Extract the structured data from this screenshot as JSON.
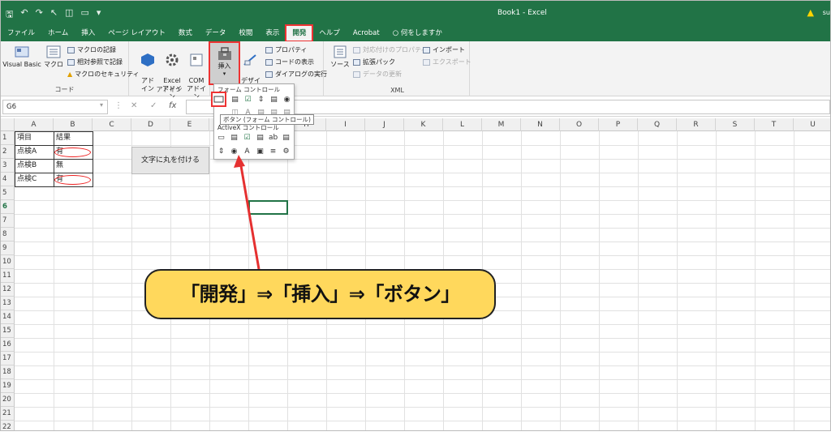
{
  "title_bar": {
    "qat_icons": [
      "save-icon",
      "undo-icon",
      "redo-icon",
      "pointer-icon",
      "form-icon",
      "window-icon",
      "customize-icon"
    ],
    "window_title": "Book1  -  Excel",
    "user": "su"
  },
  "tabs": [
    "ファイル",
    "ホーム",
    "挿入",
    "ページ レイアウト",
    "数式",
    "データ",
    "校閲",
    "表示",
    "開発",
    "ヘルプ",
    "Acrobat",
    "何をしますか"
  ],
  "active_tab": "開発",
  "ribbon": {
    "code": {
      "label": "コード",
      "visual_basic": "Visual Basic",
      "macro": "マクロ",
      "record": "マクロの記録",
      "relative": "相対参照で記録",
      "security": "マクロのセキュリティ"
    },
    "addins": {
      "label": "アドイン",
      "addin": "アド\nイン",
      "excel_addin": "Excel\nアドイン",
      "com_addin": "COM\nアドイン"
    },
    "controls": {
      "insert": "挿入",
      "design_mode": "デザイン\nモード",
      "properties": "プロパティ",
      "view_code": "コードの表示",
      "run_dialog": "ダイアログの実行"
    },
    "xml": {
      "label": "XML",
      "source": "ソース",
      "map_props": "対応付けのプロパティ",
      "expansion": "拡張パック",
      "refresh": "データの更新",
      "import": "インポート",
      "export": "エクスポート"
    }
  },
  "formula_bar": {
    "name_box": "G6",
    "fx": "fx"
  },
  "columns": [
    "A",
    "B",
    "C",
    "D",
    "E",
    "F",
    "G",
    "H",
    "I",
    "J",
    "K",
    "L",
    "M",
    "N",
    "O",
    "P",
    "Q",
    "R",
    "S",
    "T",
    "U"
  ],
  "rows": [
    "1",
    "2",
    "3",
    "4",
    "5",
    "6",
    "7",
    "8",
    "9",
    "10",
    "11",
    "12",
    "13",
    "14",
    "15",
    "16",
    "17",
    "18",
    "19",
    "20",
    "21",
    "22"
  ],
  "table": {
    "header_item": "項目",
    "header_result": "結果",
    "rows": [
      {
        "item": "点検A",
        "result": "有"
      },
      {
        "item": "点検B",
        "result": "無"
      },
      {
        "item": "点検C",
        "result": "有"
      }
    ]
  },
  "macro_button": "文字に丸を付ける",
  "dropdown": {
    "form_controls_label": "フォーム コントロール",
    "activex_label": "ActiveX コントロール",
    "tooltip": "ボタン (フォーム コントロール)"
  },
  "callout": "「開発」⇒「挿入」⇒「ボタン」",
  "colors": {
    "excel_green": "#217346",
    "highlight_red": "#e33333",
    "callout_yellow": "#ffd85c"
  }
}
